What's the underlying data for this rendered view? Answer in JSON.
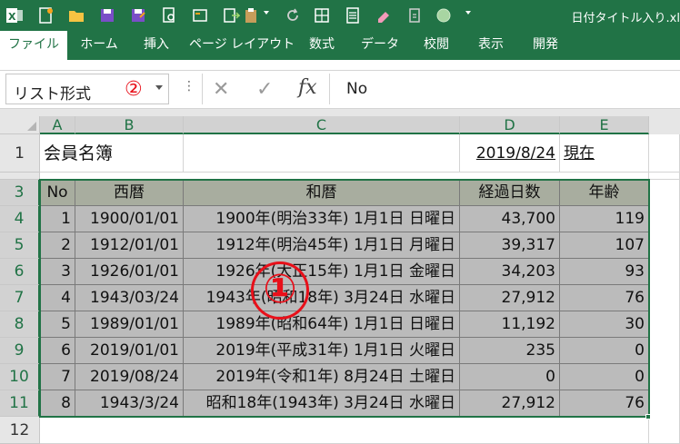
{
  "window": {
    "title": "日付タイトル入り.xl"
  },
  "ribbon": {
    "tabs": [
      "ファイル",
      "ホーム",
      "挿入",
      "ページ レイアウト",
      "数式",
      "データ",
      "校閲",
      "表示",
      "開発"
    ],
    "active_tab": "ファイル"
  },
  "formula_bar": {
    "name_box": "リスト形式",
    "marker": "②",
    "cancel_icon": "✕",
    "enter_icon": "✓",
    "fx_label": "fx",
    "value": "No"
  },
  "sheet": {
    "columns": [
      "A",
      "B",
      "C",
      "D",
      "E"
    ],
    "rows": [
      "1",
      "2",
      "3",
      "4",
      "5",
      "6",
      "7",
      "8",
      "9",
      "10",
      "11",
      "12"
    ],
    "title_cell": "会員名簿",
    "date_cell": "2019/8/24",
    "as_of_cell": "現在",
    "table_headers": [
      "No",
      "西暦",
      "和暦",
      "経過日数",
      "年齢"
    ],
    "table_rows": [
      [
        "1",
        "1900/01/01",
        "1900年(明治33年) 1月1日 日曜日",
        "43,700",
        "119"
      ],
      [
        "2",
        "1912/01/01",
        "1912年(明治45年) 1月1日 月曜日",
        "39,317",
        "107"
      ],
      [
        "3",
        "1926/01/01",
        "1926年(大正15年) 1月1日 金曜日",
        "34,203",
        "93"
      ],
      [
        "4",
        "1943/03/24",
        "1943年(昭和18年) 3月24日 水曜日",
        "27,912",
        "76"
      ],
      [
        "5",
        "1989/01/01",
        "1989年(昭和64年) 1月1日 日曜日",
        "11,192",
        "30"
      ],
      [
        "6",
        "2019/01/01",
        "2019年(平成31年) 1月1日 火曜日",
        "235",
        "0"
      ],
      [
        "7",
        "2019/08/24",
        "2019年(令和1年) 8月24日 土曜日",
        "0",
        "0"
      ],
      [
        "8",
        "1943/3/24",
        "昭和18年(1943年) 3月24日 水曜日",
        "27,912",
        "76"
      ]
    ],
    "big_marker": "①"
  },
  "colors": {
    "excel_green": "#217346",
    "marker_red": "#e8101a",
    "table_gray": "#bbbbbb",
    "header_gray": "#a8ad9f"
  }
}
